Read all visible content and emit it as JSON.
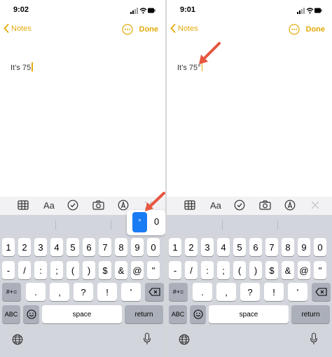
{
  "screens": [
    {
      "time": "9:02",
      "back_label": "Notes",
      "done_label": "Done",
      "note_text": "It’s 75",
      "accent": "#e3aa0b",
      "popup": {
        "selected": "°",
        "other": "0"
      }
    },
    {
      "time": "9:01",
      "back_label": "Notes",
      "done_label": "Done",
      "note_text": "It’s 75°",
      "accent": "#e3aa0b"
    }
  ],
  "toolbar": {
    "format_label": "Aa",
    "icons": [
      "table-icon",
      "checklist-icon",
      "camera-icon",
      "markup-icon",
      "close-icon"
    ]
  },
  "keyboard": {
    "row1": [
      "1",
      "2",
      "3",
      "4",
      "5",
      "6",
      "7",
      "8",
      "9",
      "0"
    ],
    "row2": [
      "-",
      "/",
      ":",
      ";",
      "(",
      ")",
      "$",
      "&",
      "@",
      "\""
    ],
    "row3": [
      ".",
      ",",
      "?",
      "!",
      "'"
    ],
    "symbols_key": "#+=",
    "abc_key": "ABC",
    "space_label": "space",
    "return_label": "return"
  },
  "annotation_color": "#e8563f"
}
